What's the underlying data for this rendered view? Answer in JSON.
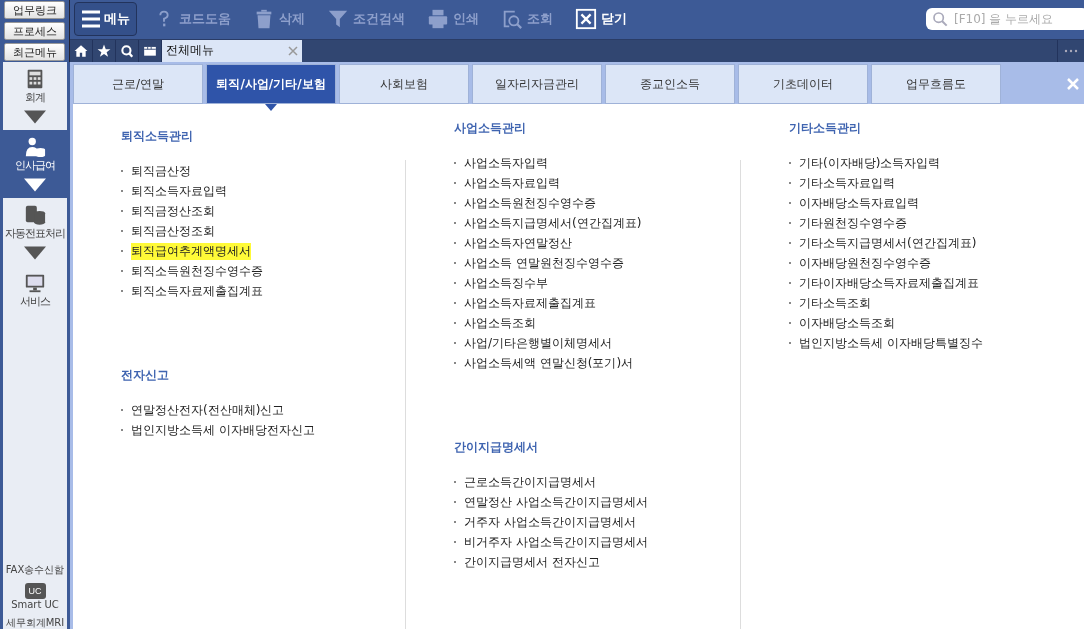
{
  "quick_buttons": [
    "업무링크",
    "프로세스",
    "최근메뉴"
  ],
  "sidebar": {
    "items": [
      {
        "label": "회계",
        "selected": false,
        "caret": true
      },
      {
        "label": "인사급여",
        "selected": true,
        "caret": true
      },
      {
        "label": "자동전표처리",
        "selected": false,
        "caret": true
      },
      {
        "label": "서비스",
        "selected": false,
        "caret": false
      }
    ],
    "bottom": [
      {
        "label": "FAX송수신함"
      },
      {
        "label": "Smart UC",
        "icon_text": "UC"
      },
      {
        "label": "세무회계MRI"
      }
    ]
  },
  "toolbar": {
    "menu_button": "메뉴",
    "items": [
      {
        "label": "코드도움",
        "disabled": true
      },
      {
        "label": "삭제",
        "disabled": true
      },
      {
        "label": "조건검색",
        "disabled": true
      },
      {
        "label": "인쇄",
        "disabled": true
      },
      {
        "label": "조회",
        "disabled": true
      },
      {
        "label": "닫기",
        "disabled": false
      }
    ],
    "search": {
      "placeholder": "[F10] 을 누르세요"
    }
  },
  "doc_tabs": [
    {
      "label": "전체메뉴",
      "selected": true
    }
  ],
  "menu_tabs": [
    {
      "label": "근로/연말",
      "selected": false
    },
    {
      "label": "퇴직/사업/기타/보험",
      "selected": true
    },
    {
      "label": "사회보험",
      "selected": false
    },
    {
      "label": "일자리자금관리",
      "selected": false
    },
    {
      "label": "종교인소득",
      "selected": false
    },
    {
      "label": "기초데이터",
      "selected": false
    },
    {
      "label": "업무흐름도",
      "selected": false
    }
  ],
  "columns": [
    {
      "sections": [
        {
          "title": "퇴직소득관리",
          "items": [
            {
              "label": "퇴직금산정",
              "highlighted": false
            },
            {
              "label": "퇴직소득자료입력",
              "highlighted": false
            },
            {
              "label": "퇴직금정산조회",
              "highlighted": false
            },
            {
              "label": "퇴직금산정조회",
              "highlighted": false
            },
            {
              "label": "퇴직급여추계액명세서",
              "highlighted": true
            },
            {
              "label": "퇴직소득원천징수영수증",
              "highlighted": false
            },
            {
              "label": "퇴직소득자료제출집계표",
              "highlighted": false
            }
          ]
        },
        {
          "title": "전자신고",
          "items": [
            {
              "label": "연말정산전자(전산매체)신고",
              "highlighted": false
            },
            {
              "label": "법인지방소득세 이자배당전자신고",
              "highlighted": false
            }
          ]
        }
      ]
    },
    {
      "sections": [
        {
          "title": "사업소득관리",
          "items": [
            {
              "label": "사업소득자입력",
              "highlighted": false
            },
            {
              "label": "사업소득자료입력",
              "highlighted": false
            },
            {
              "label": "사업소득원천징수영수증",
              "highlighted": false
            },
            {
              "label": "사업소득지급명세서(연간집계표)",
              "highlighted": false
            },
            {
              "label": "사업소득자연말정산",
              "highlighted": false
            },
            {
              "label": "사업소득 연말원천징수영수증",
              "highlighted": false
            },
            {
              "label": "사업소득징수부",
              "highlighted": false
            },
            {
              "label": "사업소득자료제출집계표",
              "highlighted": false
            },
            {
              "label": "사업소득조회",
              "highlighted": false
            },
            {
              "label": "사업/기타은행별이체명세서",
              "highlighted": false
            },
            {
              "label": "사업소득세액 연말신청(포기)서",
              "highlighted": false
            }
          ]
        },
        {
          "title": "간이지급명세서",
          "items": [
            {
              "label": "근로소득간이지급명세서",
              "highlighted": false
            },
            {
              "label": "연말정산 사업소득간이지급명세서",
              "highlighted": false
            },
            {
              "label": "거주자 사업소득간이지급명세서",
              "highlighted": false
            },
            {
              "label": "비거주자 사업소득간이지급명세서",
              "highlighted": false
            },
            {
              "label": "간이지급명세서 전자신고",
              "highlighted": false
            }
          ]
        }
      ]
    },
    {
      "sections": [
        {
          "title": "기타소득관리",
          "items": [
            {
              "label": "기타(이자배당)소득자입력",
              "highlighted": false
            },
            {
              "label": "기타소득자료입력",
              "highlighted": false
            },
            {
              "label": "이자배당소득자료입력",
              "highlighted": false
            },
            {
              "label": "기타원천징수영수증",
              "highlighted": false
            },
            {
              "label": "기타소득지급명세서(연간집계표)",
              "highlighted": false
            },
            {
              "label": "이자배당원천징수영수증",
              "highlighted": false
            },
            {
              "label": "기타이자배당소득자료제출집계표",
              "highlighted": false
            },
            {
              "label": "기타소득조회",
              "highlighted": false
            },
            {
              "label": "이자배당소득조회",
              "highlighted": false
            },
            {
              "label": "법인지방소득세 이자배당특별징수",
              "highlighted": false
            }
          ]
        }
      ]
    }
  ]
}
